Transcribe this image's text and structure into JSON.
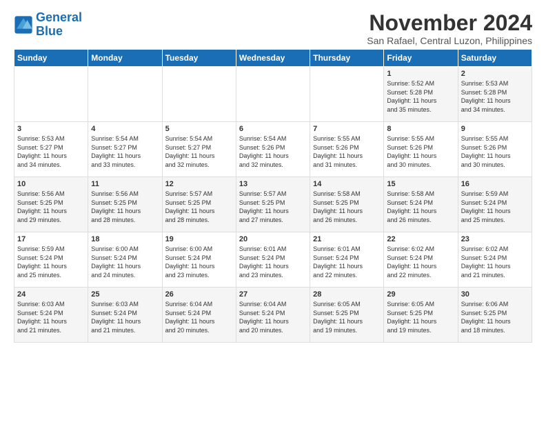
{
  "logo": {
    "line1": "General",
    "line2": "Blue"
  },
  "title": "November 2024",
  "subtitle": "San Rafael, Central Luzon, Philippines",
  "header": {
    "days": [
      "Sunday",
      "Monday",
      "Tuesday",
      "Wednesday",
      "Thursday",
      "Friday",
      "Saturday"
    ]
  },
  "weeks": [
    {
      "cells": [
        {
          "day": "",
          "info": ""
        },
        {
          "day": "",
          "info": ""
        },
        {
          "day": "",
          "info": ""
        },
        {
          "day": "",
          "info": ""
        },
        {
          "day": "",
          "info": ""
        },
        {
          "day": "1",
          "info": "Sunrise: 5:52 AM\nSunset: 5:28 PM\nDaylight: 11 hours\nand 35 minutes."
        },
        {
          "day": "2",
          "info": "Sunrise: 5:53 AM\nSunset: 5:28 PM\nDaylight: 11 hours\nand 34 minutes."
        }
      ]
    },
    {
      "cells": [
        {
          "day": "3",
          "info": "Sunrise: 5:53 AM\nSunset: 5:27 PM\nDaylight: 11 hours\nand 34 minutes."
        },
        {
          "day": "4",
          "info": "Sunrise: 5:54 AM\nSunset: 5:27 PM\nDaylight: 11 hours\nand 33 minutes."
        },
        {
          "day": "5",
          "info": "Sunrise: 5:54 AM\nSunset: 5:27 PM\nDaylight: 11 hours\nand 32 minutes."
        },
        {
          "day": "6",
          "info": "Sunrise: 5:54 AM\nSunset: 5:26 PM\nDaylight: 11 hours\nand 32 minutes."
        },
        {
          "day": "7",
          "info": "Sunrise: 5:55 AM\nSunset: 5:26 PM\nDaylight: 11 hours\nand 31 minutes."
        },
        {
          "day": "8",
          "info": "Sunrise: 5:55 AM\nSunset: 5:26 PM\nDaylight: 11 hours\nand 30 minutes."
        },
        {
          "day": "9",
          "info": "Sunrise: 5:55 AM\nSunset: 5:26 PM\nDaylight: 11 hours\nand 30 minutes."
        }
      ]
    },
    {
      "cells": [
        {
          "day": "10",
          "info": "Sunrise: 5:56 AM\nSunset: 5:25 PM\nDaylight: 11 hours\nand 29 minutes."
        },
        {
          "day": "11",
          "info": "Sunrise: 5:56 AM\nSunset: 5:25 PM\nDaylight: 11 hours\nand 28 minutes."
        },
        {
          "day": "12",
          "info": "Sunrise: 5:57 AM\nSunset: 5:25 PM\nDaylight: 11 hours\nand 28 minutes."
        },
        {
          "day": "13",
          "info": "Sunrise: 5:57 AM\nSunset: 5:25 PM\nDaylight: 11 hours\nand 27 minutes."
        },
        {
          "day": "14",
          "info": "Sunrise: 5:58 AM\nSunset: 5:25 PM\nDaylight: 11 hours\nand 26 minutes."
        },
        {
          "day": "15",
          "info": "Sunrise: 5:58 AM\nSunset: 5:24 PM\nDaylight: 11 hours\nand 26 minutes."
        },
        {
          "day": "16",
          "info": "Sunrise: 5:59 AM\nSunset: 5:24 PM\nDaylight: 11 hours\nand 25 minutes."
        }
      ]
    },
    {
      "cells": [
        {
          "day": "17",
          "info": "Sunrise: 5:59 AM\nSunset: 5:24 PM\nDaylight: 11 hours\nand 25 minutes."
        },
        {
          "day": "18",
          "info": "Sunrise: 6:00 AM\nSunset: 5:24 PM\nDaylight: 11 hours\nand 24 minutes."
        },
        {
          "day": "19",
          "info": "Sunrise: 6:00 AM\nSunset: 5:24 PM\nDaylight: 11 hours\nand 23 minutes."
        },
        {
          "day": "20",
          "info": "Sunrise: 6:01 AM\nSunset: 5:24 PM\nDaylight: 11 hours\nand 23 minutes."
        },
        {
          "day": "21",
          "info": "Sunrise: 6:01 AM\nSunset: 5:24 PM\nDaylight: 11 hours\nand 22 minutes."
        },
        {
          "day": "22",
          "info": "Sunrise: 6:02 AM\nSunset: 5:24 PM\nDaylight: 11 hours\nand 22 minutes."
        },
        {
          "day": "23",
          "info": "Sunrise: 6:02 AM\nSunset: 5:24 PM\nDaylight: 11 hours\nand 21 minutes."
        }
      ]
    },
    {
      "cells": [
        {
          "day": "24",
          "info": "Sunrise: 6:03 AM\nSunset: 5:24 PM\nDaylight: 11 hours\nand 21 minutes."
        },
        {
          "day": "25",
          "info": "Sunrise: 6:03 AM\nSunset: 5:24 PM\nDaylight: 11 hours\nand 21 minutes."
        },
        {
          "day": "26",
          "info": "Sunrise: 6:04 AM\nSunset: 5:24 PM\nDaylight: 11 hours\nand 20 minutes."
        },
        {
          "day": "27",
          "info": "Sunrise: 6:04 AM\nSunset: 5:24 PM\nDaylight: 11 hours\nand 20 minutes."
        },
        {
          "day": "28",
          "info": "Sunrise: 6:05 AM\nSunset: 5:25 PM\nDaylight: 11 hours\nand 19 minutes."
        },
        {
          "day": "29",
          "info": "Sunrise: 6:05 AM\nSunset: 5:25 PM\nDaylight: 11 hours\nand 19 minutes."
        },
        {
          "day": "30",
          "info": "Sunrise: 6:06 AM\nSunset: 5:25 PM\nDaylight: 11 hours\nand 18 minutes."
        }
      ]
    }
  ]
}
